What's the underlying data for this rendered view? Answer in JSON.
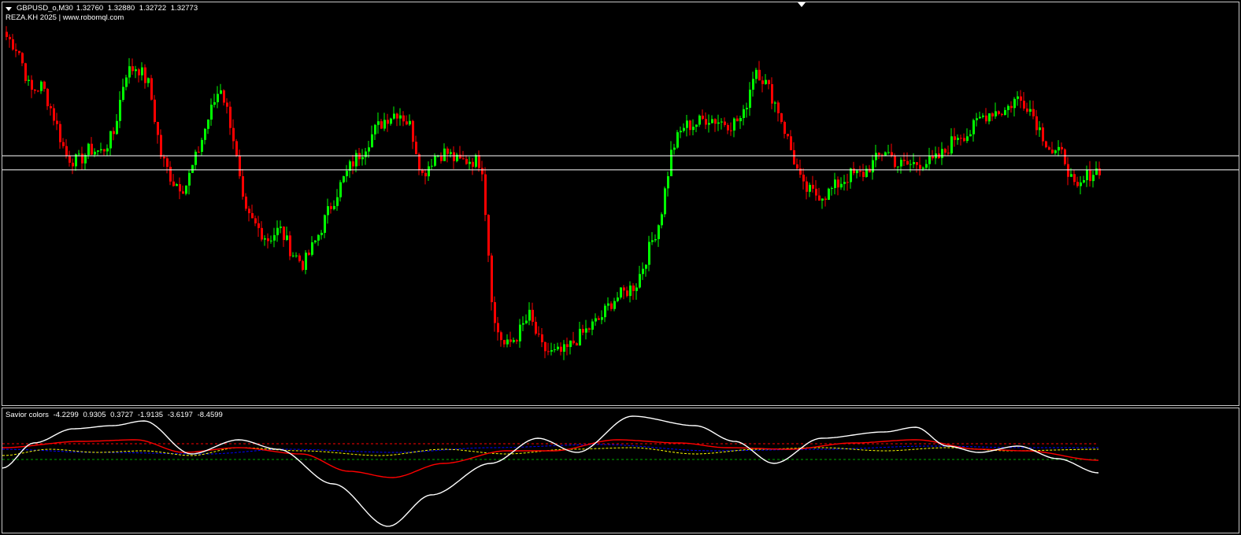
{
  "chart": {
    "symbol_timeframe": "GBPUSD_o,M30",
    "ohlc": [
      "1.32760",
      "1.32880",
      "1.32722",
      "1.32773"
    ],
    "watermark": "REZA.KH 2025 | www.robomql.com",
    "colors": {
      "background": "#000000",
      "bull": "#00ff00",
      "bear": "#ff0000",
      "hline": "#ffffff"
    },
    "price_scale": {
      "min": 1.3185,
      "max": 1.349
    },
    "horizontal_lines": [
      1.3375,
      1.3364
    ],
    "close_series": [
      1.3468,
      1.3458,
      1.3425,
      1.343,
      1.3405,
      1.3375,
      1.337,
      1.338,
      1.3378,
      1.3392,
      1.344,
      1.3445,
      1.343,
      1.3375,
      1.3355,
      1.335,
      1.3375,
      1.3405,
      1.343,
      1.3395,
      1.333,
      1.332,
      1.331,
      1.3318,
      1.33,
      1.329,
      1.3308,
      1.333,
      1.335,
      1.3368,
      1.338,
      1.3395,
      1.3405,
      1.341,
      1.3398,
      1.336,
      1.3375,
      1.3378,
      1.337,
      1.3372,
      1.337,
      1.3245,
      1.3225,
      1.3235,
      1.325,
      1.3225,
      1.322,
      1.3222,
      1.3232,
      1.324,
      1.3248,
      1.3262,
      1.3268,
      1.3275,
      1.33,
      1.3325,
      1.338,
      1.3398,
      1.34,
      1.3405,
      1.3402,
      1.34,
      1.3405,
      1.3445,
      1.343,
      1.341,
      1.338,
      1.335,
      1.3345,
      1.3345,
      1.3353,
      1.336,
      1.336,
      1.337,
      1.338,
      1.3368,
      1.3368,
      1.337,
      1.337,
      1.3378,
      1.3392,
      1.3392,
      1.3405,
      1.341,
      1.341,
      1.342,
      1.3415,
      1.3395,
      1.3378,
      1.3375,
      1.3345,
      1.336,
      1.3365
    ]
  },
  "indicator": {
    "name": "Savior colors",
    "values": [
      "-4.2299",
      "0.9305",
      "0.3727",
      "-1.9135",
      "-3.6197",
      "-8.4599"
    ],
    "colors": {
      "main": "#ffffff",
      "signal": "#ff0000",
      "level_high": "#ff0000",
      "level_low": "#00aa00",
      "dotted_blue": "#0000ff",
      "dotted_yellow": "#ffff00"
    }
  }
}
